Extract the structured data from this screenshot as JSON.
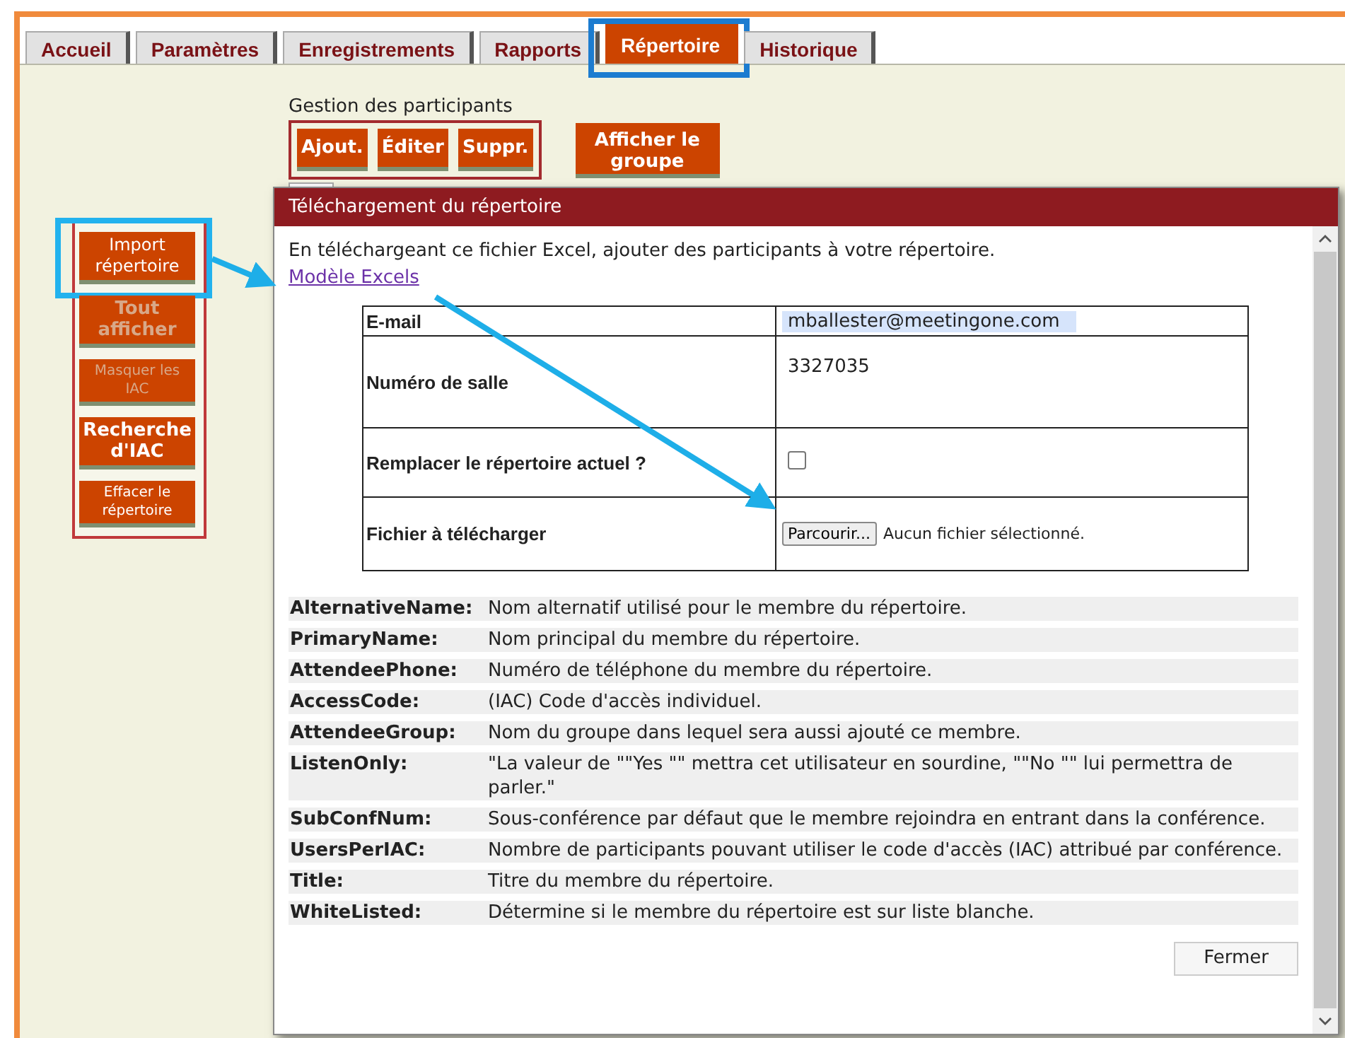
{
  "tabs": [
    {
      "label": "Accueil",
      "selected": false
    },
    {
      "label": "Paramètres",
      "selected": false
    },
    {
      "label": "Enregistrements",
      "selected": false
    },
    {
      "label": "Rapports",
      "selected": false
    },
    {
      "label": "Répertoire",
      "selected": true
    },
    {
      "label": "Historique",
      "selected": false
    }
  ],
  "participant_management": {
    "title": "Gestion des participants",
    "buttons": [
      "Ajout.",
      "Éditer",
      "Suppr."
    ]
  },
  "group_button": "Afficher le groupe",
  "side_buttons": [
    {
      "label": "Import répertoire",
      "disabled": false,
      "kind": "plain"
    },
    {
      "label": "Tout afficher",
      "disabled": true,
      "kind": "bold"
    },
    {
      "label": "Masquer les IAC",
      "disabled": true,
      "kind": "small"
    },
    {
      "label": "Recherche d'IAC",
      "disabled": false,
      "kind": "bold"
    },
    {
      "label": "Effacer le répertoire",
      "disabled": false,
      "kind": "small"
    }
  ],
  "dialog": {
    "title": "Téléchargement du répertoire",
    "intro": "En téléchargeant ce fichier Excel, ajouter des participants à votre répertoire.",
    "link": "Modèle Excels",
    "form": [
      {
        "kind": "input",
        "label": "E-mail",
        "value": "mballester@meetingone.com"
      },
      {
        "kind": "value",
        "label": "Numéro de salle",
        "value": "3327035"
      },
      {
        "kind": "checkbox",
        "label": "Remplacer le répertoire actuel ?",
        "checked": false
      },
      {
        "kind": "file",
        "label": "Fichier à télécharger",
        "button": "Parcourir...",
        "status": "Aucun fichier sélectionné."
      }
    ],
    "fields": [
      {
        "name": "AlternativeName:",
        "description": "Nom alternatif utilisé pour le membre du répertoire."
      },
      {
        "name": "PrimaryName:",
        "description": "Nom principal du membre du répertoire."
      },
      {
        "name": "AttendeePhone:",
        "description": "Numéro de téléphone du membre du répertoire."
      },
      {
        "name": "AccessCode:",
        "description": "(IAC) Code d'accès individuel."
      },
      {
        "name": "AttendeeGroup:",
        "description": "Nom du groupe dans lequel sera aussi ajouté ce membre."
      },
      {
        "name": "ListenOnly:",
        "description": "\"La valeur de \"\"Yes \"\" mettra cet utilisateur en sourdine, \"\"No \"\" lui permettra de parler.\""
      },
      {
        "name": "SubConfNum:",
        "description": "Sous-conférence par défaut que le membre rejoindra en entrant dans la conférence."
      },
      {
        "name": "UsersPerIAC:",
        "description": "Nombre de participants pouvant utiliser le code d'accès (IAC) attribué par conférence."
      },
      {
        "name": "Title:",
        "description": "Titre du membre du répertoire."
      },
      {
        "name": "WhiteListed:",
        "description": "Détermine si le membre du répertoire est sur liste blanche."
      }
    ],
    "close_button": "Fermer"
  }
}
